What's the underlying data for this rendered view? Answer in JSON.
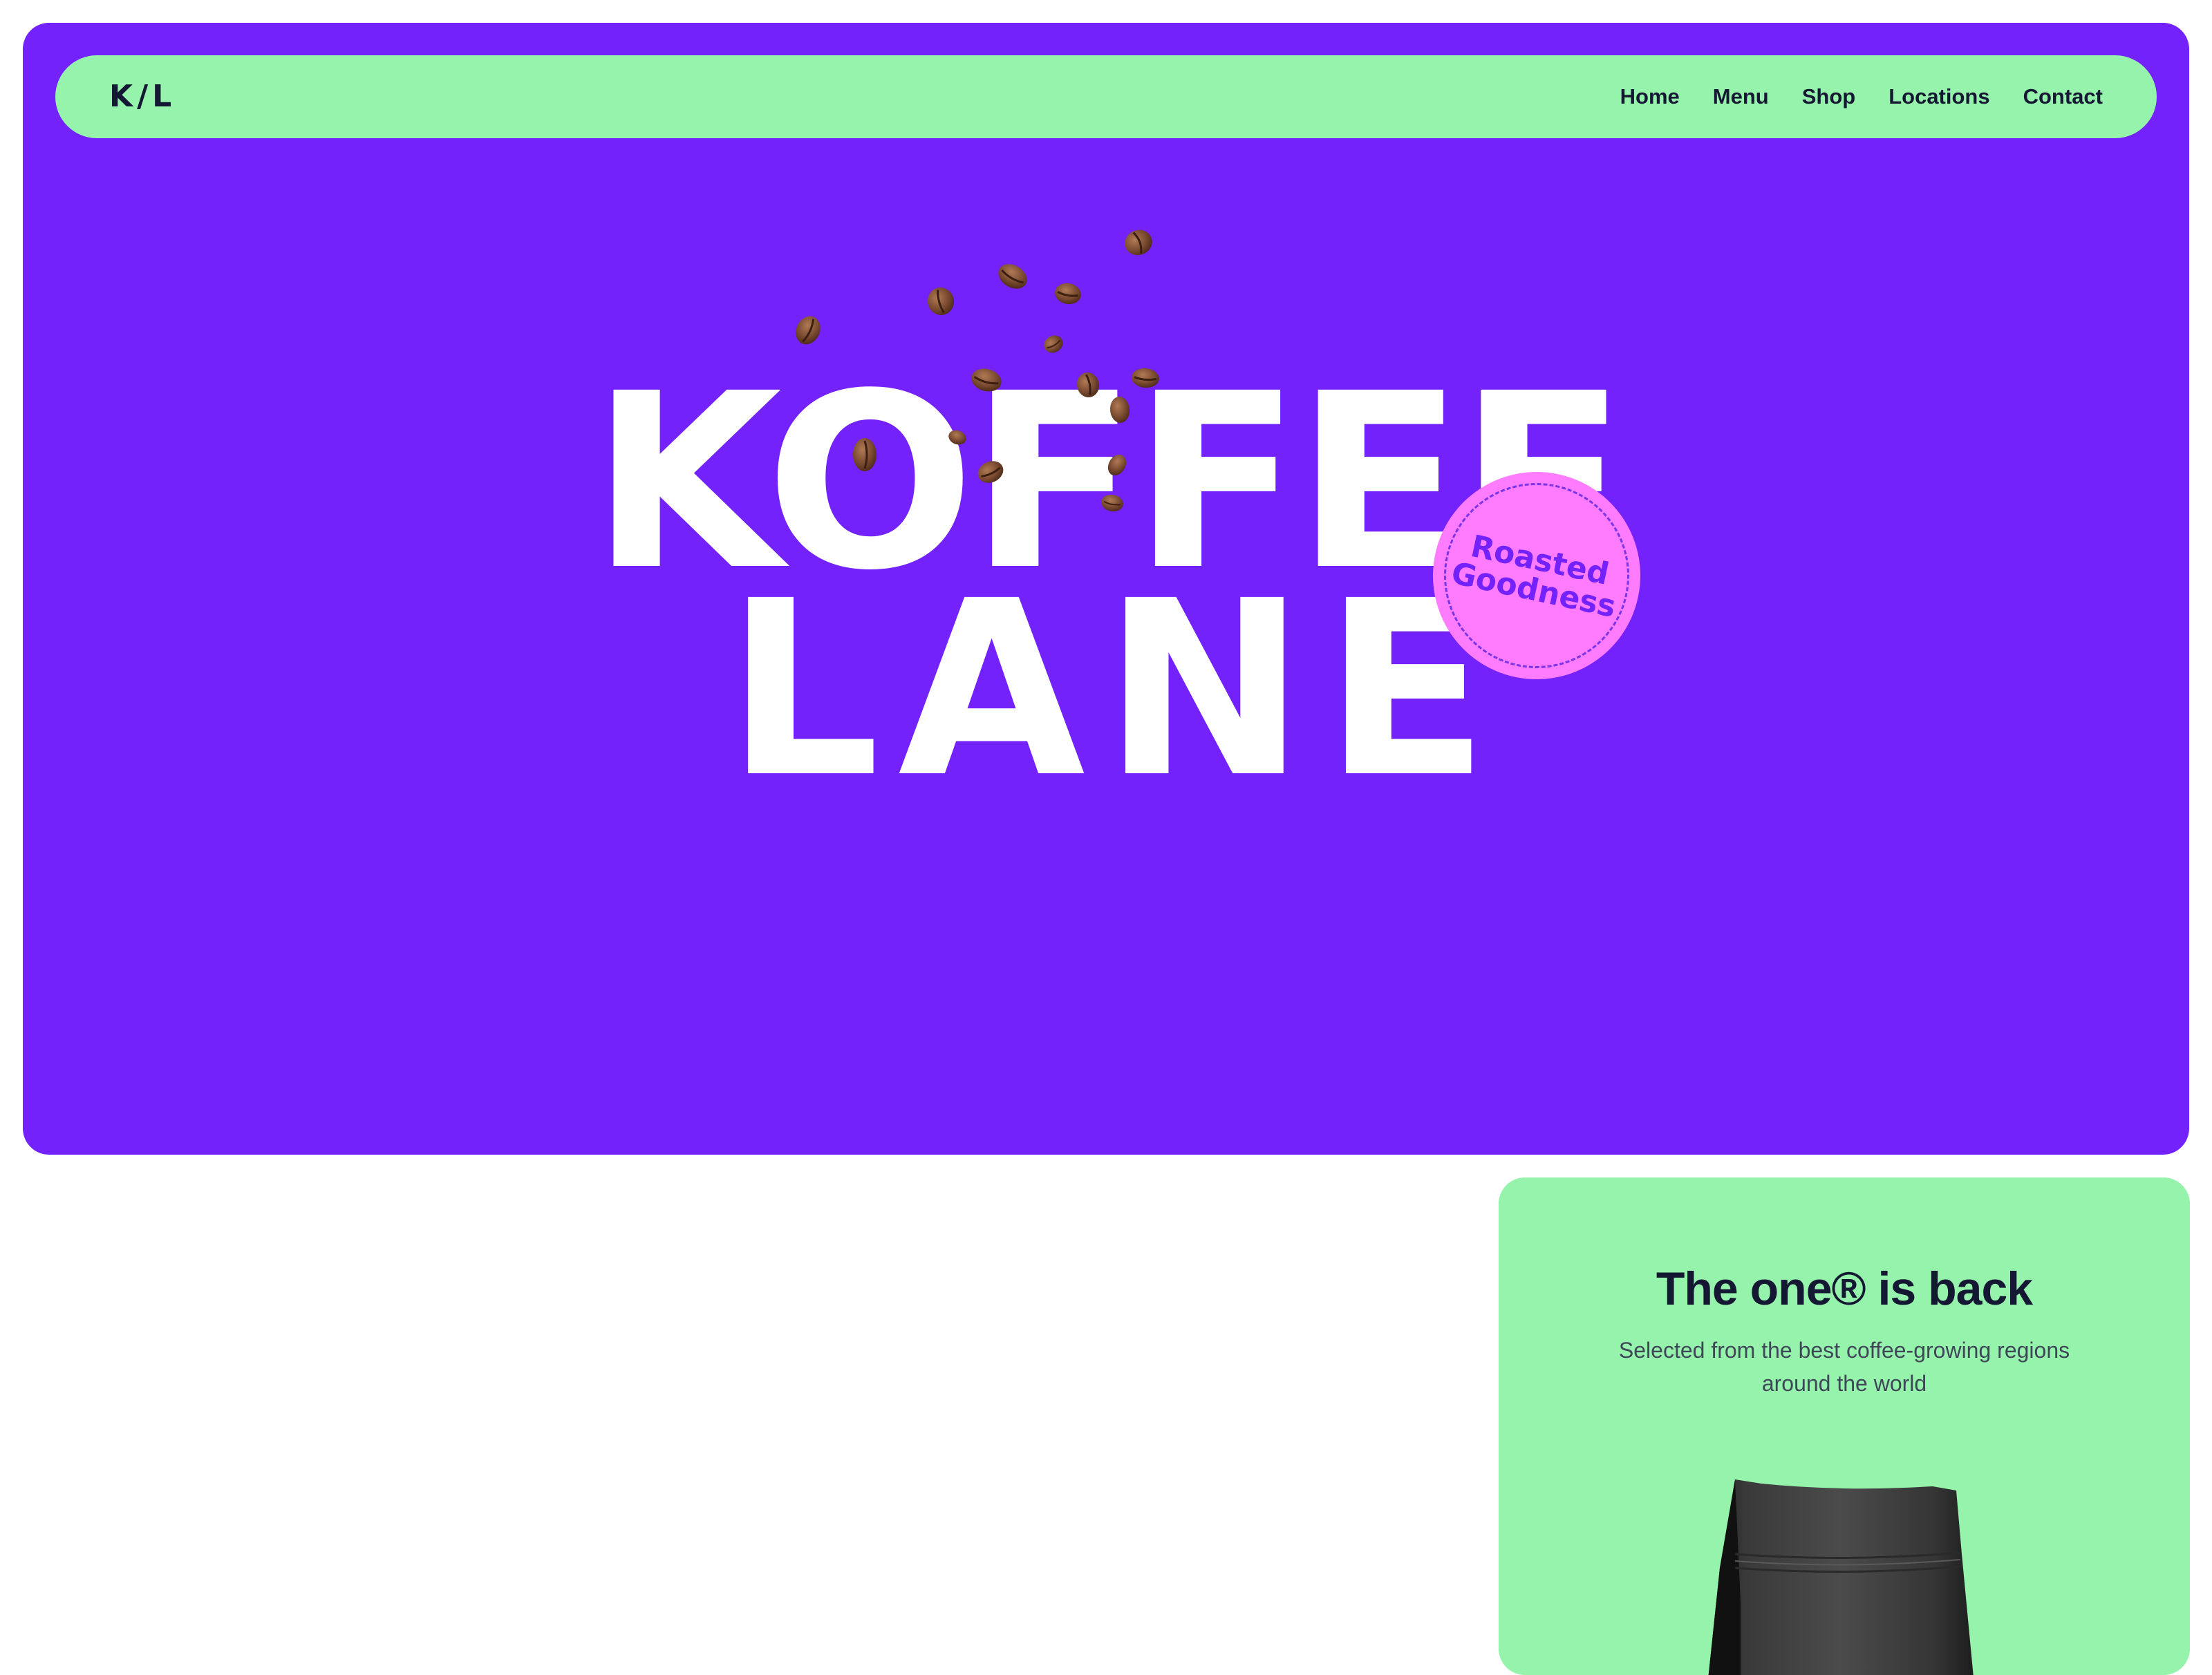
{
  "brand": {
    "logo_text": "K/L"
  },
  "nav": {
    "items": [
      {
        "label": "Home"
      },
      {
        "label": "Menu"
      },
      {
        "label": "Shop"
      },
      {
        "label": "Locations"
      },
      {
        "label": "Contact"
      }
    ]
  },
  "hero": {
    "title_line_1": "KOFFEE",
    "title_line_2": "LANE",
    "background_color": "#7322fc",
    "badge": {
      "line_1": "Roasted",
      "line_2": "Goodness",
      "color": "#ff7bff"
    }
  },
  "product": {
    "title": "The one® is back",
    "subtitle": "Selected from the best coffee-growing regions around the world",
    "card_color": "#96f3ab"
  },
  "icons": {
    "coffee_beans": "coffee-beans-icon",
    "coffee_bag": "coffee-bag-icon"
  }
}
